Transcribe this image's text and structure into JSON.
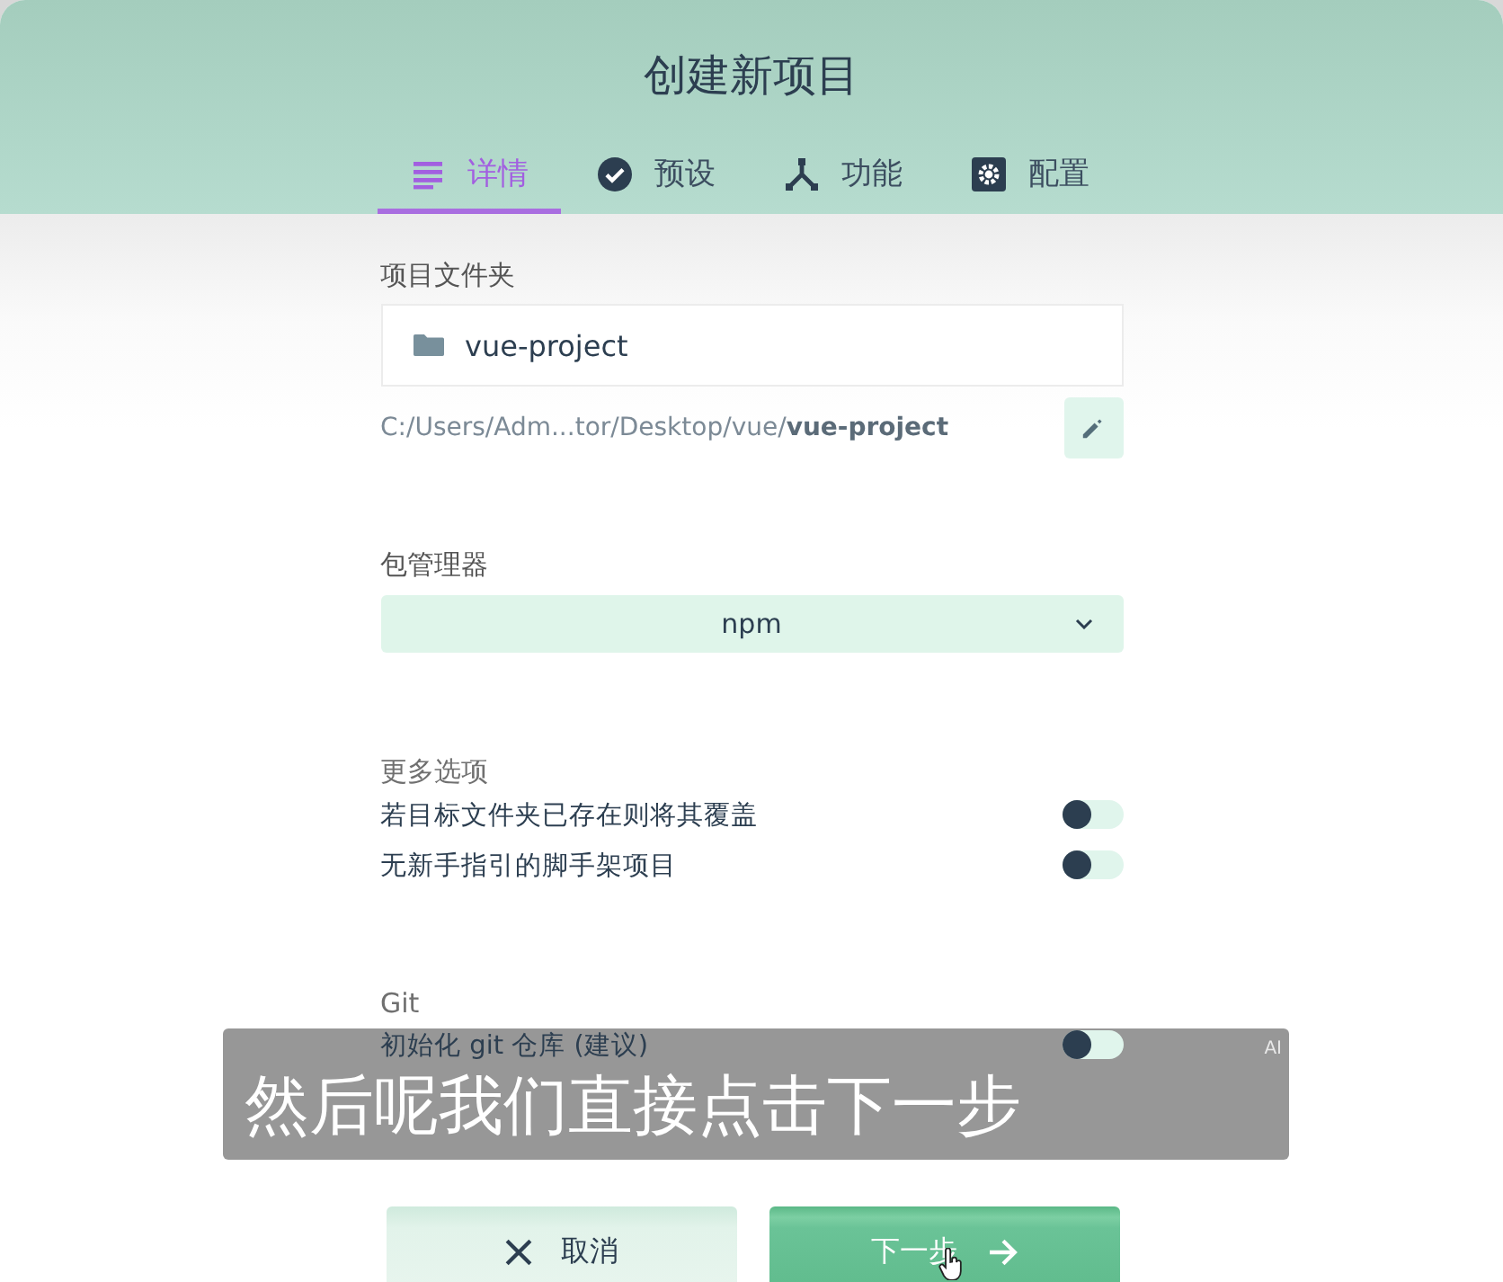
{
  "window": {
    "title": "创建新项目"
  },
  "tabs": [
    {
      "label": "详情",
      "selected": true
    },
    {
      "label": "预设",
      "selected": false
    },
    {
      "label": "功能",
      "selected": false
    },
    {
      "label": "配置",
      "selected": false
    }
  ],
  "folder": {
    "label": "项目文件夹",
    "value": "vue-project",
    "path": "C:/Users/Adm...tor/Desktop/vue/**vue-project**"
  },
  "package_manager": {
    "label": "包管理器",
    "value": "npm"
  },
  "sections": [
    {
      "title": "更多选项",
      "options": [
        {
          "label": "若目标文件夹已存在则将其覆盖",
          "on": false
        },
        {
          "label": "无新手指引的脚手架项目",
          "on": false
        }
      ]
    },
    {
      "title": "Git",
      "options": [
        {
          "label": "初始化 git 仓库 (建议)",
          "on": false
        }
      ]
    }
  ],
  "buttons": [
    {
      "label": "取消",
      "kind": "cancel"
    },
    {
      "label": "下一步",
      "kind": "next"
    }
  ],
  "subtitle": {
    "text": "然后呢我们直接点击下一步",
    "badge": "AI"
  }
}
